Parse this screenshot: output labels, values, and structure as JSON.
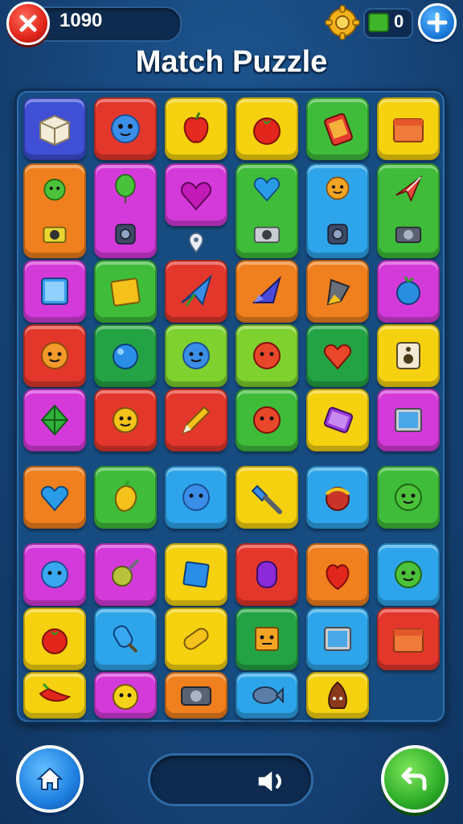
{
  "header": {
    "score": "1090",
    "level": "0",
    "title": "Match Puzzle"
  },
  "icons": {
    "close": "close-icon",
    "settings": "gear-icon",
    "level": "level-icon",
    "add": "plus-icon",
    "home": "home-icon",
    "sound": "speaker-icon",
    "undo": "undo-icon"
  },
  "colors": {
    "close_button": "#e0241a",
    "plus_button": "#1a78d8",
    "home_button": "#1f7fe0",
    "undo_button": "#2fae2a",
    "board": "#174c80"
  },
  "board": {
    "tiles": [
      {
        "item": "box",
        "color": "blue-purple"
      },
      {
        "item": "blue-monster",
        "color": "red"
      },
      {
        "item": "red-apple",
        "color": "yellow"
      },
      {
        "item": "tomato",
        "color": "yellow"
      },
      {
        "item": "phone",
        "color": "green"
      },
      {
        "item": "folder",
        "color": "yellow"
      },
      {
        "item": "green-apple",
        "color": "orange",
        "bottom_item": "camera"
      },
      {
        "item": "green-balloon",
        "color": "magenta",
        "bottom_item": "camera"
      },
      {
        "item": "heart",
        "color": "magenta"
      },
      {
        "item": "blue-heart",
        "color": "green",
        "bottom_item": "camera"
      },
      {
        "item": "orange-monster",
        "color": "sky",
        "bottom_item": "camera"
      },
      {
        "item": "paper-plane",
        "color": "green",
        "bottom_item": "camera"
      },
      {
        "item": "tablet",
        "color": "magenta"
      },
      {
        "item": "sticky-note",
        "color": "green"
      },
      {
        "item": "paper-plane",
        "color": "red"
      },
      {
        "item": "rocket",
        "color": "orange"
      },
      {
        "item": "pencil-tip",
        "color": "orange"
      },
      {
        "item": "berry",
        "color": "magenta"
      },
      {
        "item": "orange-monster",
        "color": "red"
      },
      {
        "item": "blue-ball",
        "color": "darkgreen"
      },
      {
        "item": "blue-monster",
        "color": "lime"
      },
      {
        "item": "red-monster",
        "color": "lime"
      },
      {
        "item": "red-heart",
        "color": "darkgreen"
      },
      {
        "item": "speaker",
        "color": "yellow"
      },
      {
        "item": "kite",
        "color": "magenta"
      },
      {
        "item": "sun-monster",
        "color": "red"
      },
      {
        "item": "pencil",
        "color": "red"
      },
      {
        "item": "red-monster",
        "color": "green"
      },
      {
        "item": "phone",
        "color": "yellow"
      },
      {
        "item": "tablet",
        "color": "magenta"
      },
      {
        "item": "blue-heart",
        "color": "orange"
      },
      {
        "item": "mango",
        "color": "green"
      },
      {
        "item": "blue-monster",
        "color": "sky"
      },
      {
        "item": "brush",
        "color": "yellow"
      },
      {
        "item": "ball",
        "color": "sky"
      },
      {
        "item": "green-monster",
        "color": "green"
      },
      {
        "item": "blue-monster",
        "color": "magenta"
      },
      {
        "item": "lollipop",
        "color": "magenta"
      },
      {
        "item": "blue-square",
        "color": "yellow"
      },
      {
        "item": "purple-gem",
        "color": "red"
      },
      {
        "item": "red-heart",
        "color": "orange"
      },
      {
        "item": "green-monster",
        "color": "sky"
      },
      {
        "item": "tomato",
        "color": "yellow"
      },
      {
        "item": "popsicle",
        "color": "sky"
      },
      {
        "item": "yellow-bar",
        "color": "yellow"
      },
      {
        "item": "box-monster",
        "color": "darkgreen"
      },
      {
        "item": "tablet",
        "color": "sky"
      },
      {
        "item": "folder",
        "color": "red"
      },
      {
        "item": "chili",
        "color": "yellow"
      },
      {
        "item": "chick",
        "color": "magenta"
      },
      {
        "item": "camera",
        "color": "orange"
      },
      {
        "item": "fish",
        "color": "sky"
      },
      {
        "item": "chestnut",
        "color": "yellow"
      }
    ]
  }
}
